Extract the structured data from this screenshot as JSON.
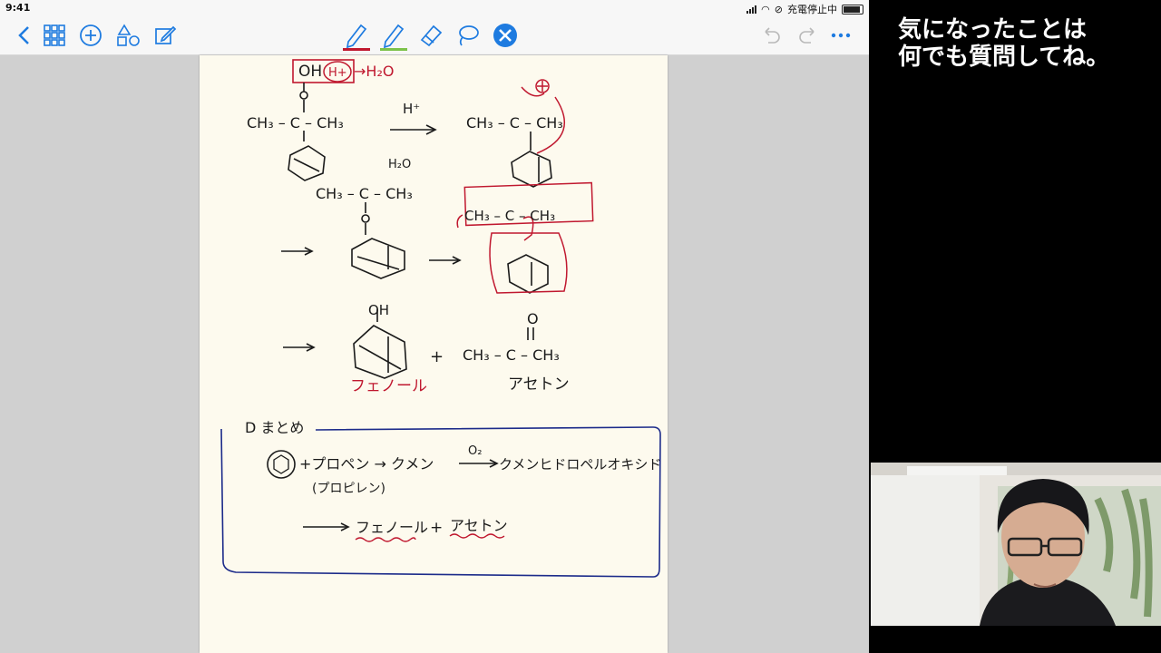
{
  "status": {
    "time": "9:41",
    "charging": "充電停止中"
  },
  "caption": {
    "line1": "気になったことは",
    "line2": "何でも質問してね。"
  },
  "note": {
    "top_formula": {
      "oh": "OH",
      "h": "H+",
      "water": "→H₂O"
    },
    "reaction1": {
      "left": "CH₃ – C – CH₃",
      "arrow_label": "H⁺",
      "right": "CH₃ – C – CH₃",
      "water": "H₂O"
    },
    "reaction2": {
      "mid": "CH₃ – C – CH₃",
      "boxed": "CH₃ – C – CH₃"
    },
    "reaction3": {
      "oh": "OH",
      "acetone_o": "O",
      "acetone": "CH₃ – C – CH₃",
      "plus": "+"
    },
    "labels": {
      "phenol": "フェノール",
      "acetone": "アセトン"
    },
    "summary": {
      "heading": "D まとめ",
      "line1": "+プロペン → クメン",
      "o2": "O₂",
      "line1b": "クメンヒドロペルオキシド",
      "line2": "(プロピレン)",
      "result_phenol": "フェノール",
      "plus": "+",
      "result_acetone": "アセトン"
    }
  },
  "colors": {
    "pen_red": "#c0182f",
    "pen_green": "#7cc24a",
    "lasso_selected": "#1e7be0",
    "summary_box": "#1c2b8a"
  },
  "toolbar_icons": [
    "back-icon",
    "grid-icon",
    "add-icon",
    "shapes-icon",
    "edit-icon",
    "pen-icon",
    "highlighter-icon",
    "eraser-icon",
    "lasso-icon",
    "close-icon",
    "undo-icon",
    "redo-icon",
    "more-icon"
  ]
}
